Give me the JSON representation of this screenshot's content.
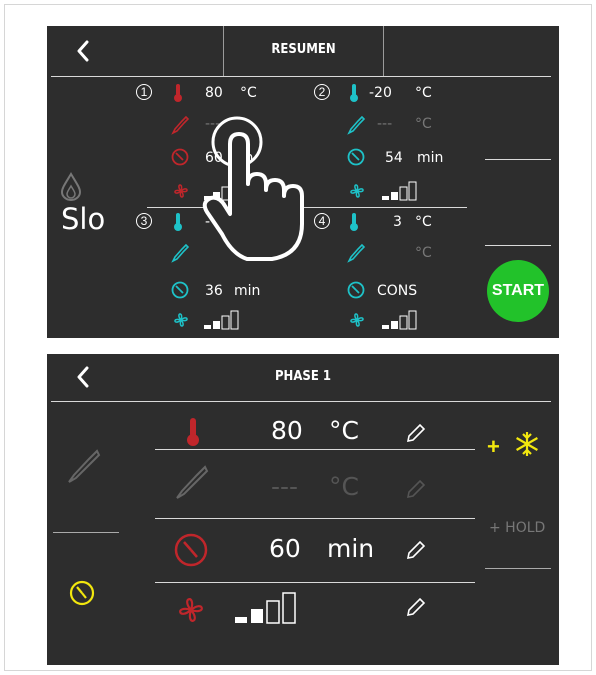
{
  "colors": {
    "panel_bg": "#2d2d2d",
    "red": "#c0262b",
    "cyan": "#1ec2c8",
    "yellow": "#f2e70e",
    "green": "#22c22a",
    "dim": "#777777"
  },
  "resumen": {
    "title": "RESUMEN",
    "back_icon": "chevron-left-icon",
    "side_text": "Slo",
    "start_label": "START",
    "phases": [
      {
        "number": "1",
        "temp": "80",
        "temp_unit": "°C",
        "probe": "---",
        "probe_unit": "°C",
        "time": "60",
        "time_unit": "min",
        "fan_level": "2"
      },
      {
        "number": "2",
        "temp": "-20",
        "temp_unit": "°C",
        "probe": "---",
        "probe_unit": "°C",
        "time": "54",
        "time_unit": "min",
        "fan_level": "2"
      },
      {
        "number": "3",
        "temp": "-",
        "temp_unit": "°C",
        "probe": "---",
        "probe_unit": "°C",
        "time": "36",
        "time_unit": "min",
        "fan_level": "2"
      },
      {
        "number": "4",
        "temp": "3",
        "temp_unit": "°C",
        "probe": "---",
        "probe_unit": "°C",
        "time": "CONS",
        "time_unit": "",
        "fan_level": "2"
      }
    ]
  },
  "phase1": {
    "title": "PHASE 1",
    "back_icon": "chevron-left-icon",
    "temp_value": "80",
    "temp_unit": "°C",
    "probe_value": "---",
    "probe_unit": "°C",
    "time_value": "60",
    "time_unit": "min",
    "fan_level": "2",
    "plus_cool": "+",
    "hold_label": "+ HOLD"
  }
}
